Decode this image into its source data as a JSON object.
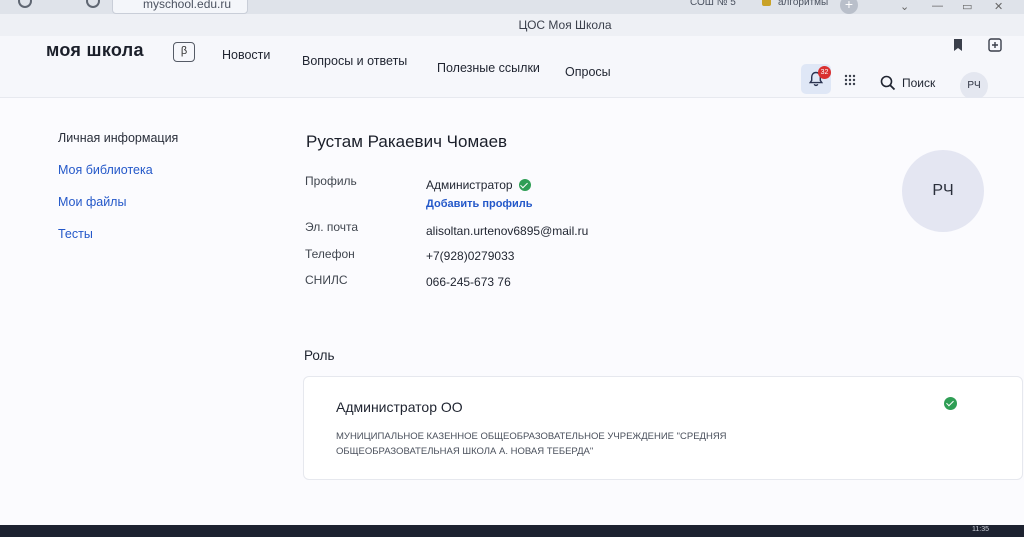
{
  "browser": {
    "url": "myschool.edu.ru",
    "window_title": "ЦОС Моя Школа",
    "tabs": [
      "СОШ № 5",
      "алгоритмы"
    ],
    "new_tab_label": "+"
  },
  "header": {
    "logo": "моя школа",
    "beta_badge": "β",
    "nav": [
      "Новости",
      "Вопросы и ответы",
      "Полезные ссылки",
      "Опросы"
    ],
    "notifications_count": "32",
    "search_label": "Поиск",
    "avatar_initials": "РЧ"
  },
  "sidebar": {
    "items": [
      {
        "label": "Личная информация"
      },
      {
        "label": "Моя библиотека"
      },
      {
        "label": "Мои файлы"
      },
      {
        "label": "Тесты"
      }
    ]
  },
  "profile": {
    "name": "Рустам Ракаевич Чомаев",
    "avatar_initials": "РЧ",
    "fields": {
      "profile_label": "Профиль",
      "profile_value": "Администратор",
      "add_profile": "Добавить профиль",
      "email_label": "Эл. почта",
      "email_value": "alisoltan.urtenov6895@mail.ru",
      "phone_label": "Телефон",
      "phone_value": "+7(928)0279033",
      "snils_label": "СНИЛС",
      "snils_value": "066-245-673 76"
    }
  },
  "role": {
    "heading": "Роль",
    "title": "Администратор ОО",
    "organization_line1": "МУНИЦИПАЛЬНОЕ КАЗЕННОЕ ОБЩЕОБРАЗОВАТЕЛЬНОЕ УЧРЕЖДЕНИЕ \"СРЕДНЯЯ",
    "organization_line2": "ОБЩЕОБРАЗОВАТЕЛЬНАЯ ШКОЛА А. НОВАЯ ТЕБЕРДА\""
  },
  "taskbar": {
    "clock": "11:35"
  },
  "colors": {
    "link": "#2458c9",
    "success": "#2f9e55",
    "badge": "#d93030"
  }
}
